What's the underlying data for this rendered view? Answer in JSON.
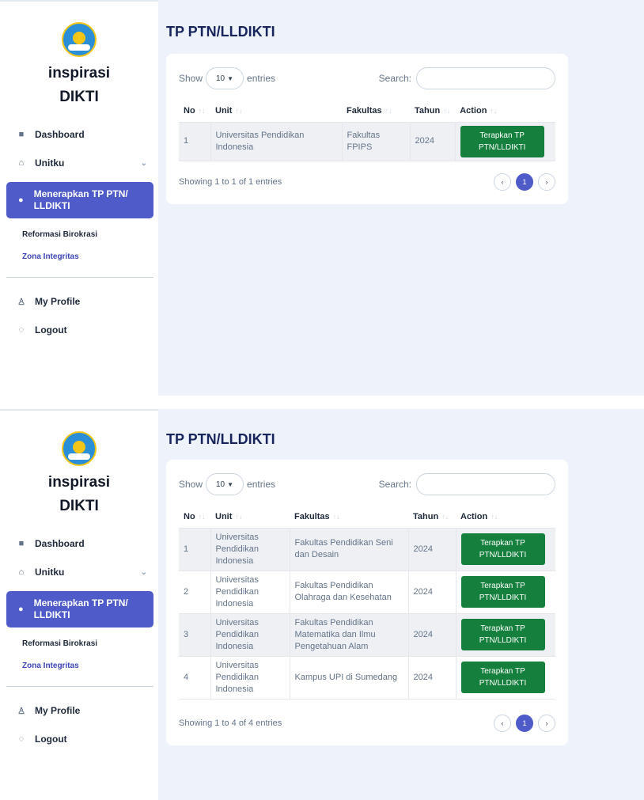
{
  "brand": {
    "line1": "inspirasi",
    "line2": "DIKTI"
  },
  "sidebar": {
    "dashboard": "Dashboard",
    "unitku": "Unitku",
    "active_item": "Menerapkan TP PTN/ LLDIKTI",
    "sub_items": [
      "Reformasi Birokrasi",
      "Zona Integritas"
    ],
    "my_profile": "My Profile",
    "logout": "Logout"
  },
  "page": {
    "title": "TP PTN/LLDIKTI"
  },
  "controls": {
    "show_label": "Show",
    "entries_value": "10",
    "entries_label": "entries",
    "search_label": "Search:"
  },
  "table": {
    "columns": [
      "No",
      "Unit",
      "Fakultas",
      "Tahun",
      "Action"
    ],
    "button_label": "Terapkan TP PTN/LLDIKTI"
  },
  "views": [
    {
      "rows": [
        {
          "no": "1",
          "unit": "Universitas Pendidikan Indonesia",
          "fakultas": "Fakultas FPIPS",
          "tahun": "2024"
        }
      ],
      "info": "Showing 1 to 1 of 1 entries"
    },
    {
      "rows": [
        {
          "no": "1",
          "unit": "Universitas Pendidikan Indonesia",
          "fakultas": "Fakultas Pendidikan Seni dan Desain",
          "tahun": "2024"
        },
        {
          "no": "2",
          "unit": "Universitas Pendidikan Indonesia",
          "fakultas": "Fakultas Pendidikan Olahraga dan Kesehatan",
          "tahun": "2024"
        },
        {
          "no": "3",
          "unit": "Universitas Pendidikan Indonesia",
          "fakultas": "Fakultas Pendidikan Matematika dan Ilmu Pengetahuan Alam",
          "tahun": "2024"
        },
        {
          "no": "4",
          "unit": "Universitas Pendidikan Indonesia",
          "fakultas": "Kampus UPI di Sumedang",
          "tahun": "2024"
        }
      ],
      "info": "Showing 1 to 4 of 4 entries"
    }
  ],
  "pagination": {
    "prev": "‹",
    "current": "1",
    "next": "›"
  },
  "colors": {
    "accent": "#4f5bc9",
    "button": "#15803d",
    "title": "#17255c",
    "main_bg": "#eef2fb"
  }
}
